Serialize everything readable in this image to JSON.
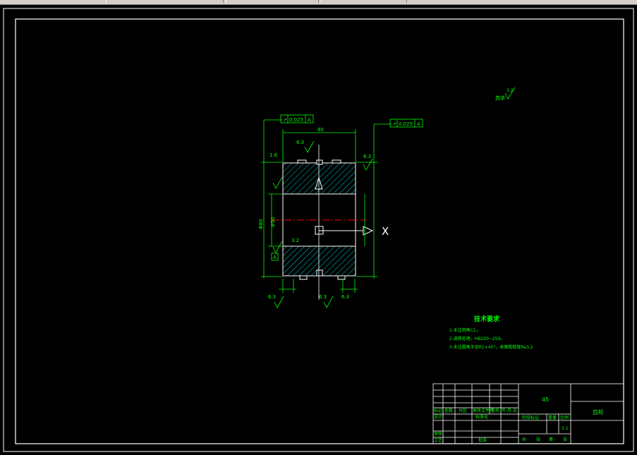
{
  "colors": {
    "background": "#000000",
    "frame": "#ffffff",
    "annotation": "#00ff00",
    "centerline": "#ff0000",
    "hatch": "#00cccc"
  },
  "drawing": {
    "dims": {
      "total_width": "80",
      "tol_left": "0.025",
      "tol_right": "0.025",
      "datum_letter": "A",
      "rough_top": "6.3",
      "rough_left": "1.6",
      "rough_right": "6.3",
      "rough_mid": "3.2",
      "rough_bottom": "6.3",
      "bore_dia": "Φ50",
      "outer_dia": "Φ80",
      "rough_corner_val": "3.2",
      "rough_corner_label": "其余",
      "x_mark": "X"
    },
    "notes": {
      "title": "技术要求",
      "items": [
        "1.未注倒角C1。",
        "2.调质处理，HB220~250。",
        "3.未注圆角半径R1×45°，表面粗糙度Ra3.2"
      ]
    },
    "title_block": {
      "material": "45",
      "part_name": "齿轮",
      "scale": "1:1",
      "row_labels": [
        "标记",
        "处数",
        "分区",
        "更改文件号",
        "签名",
        "年.月.日"
      ],
      "left_labels": [
        "设计",
        "审核",
        "工艺"
      ],
      "mid_labels": [
        "标准化",
        "批准"
      ],
      "stage_label": "阶段标记",
      "weight_label": "重量",
      "scale_label": "比例",
      "sheet_labels": [
        "共",
        "张",
        "第",
        "张"
      ]
    }
  }
}
